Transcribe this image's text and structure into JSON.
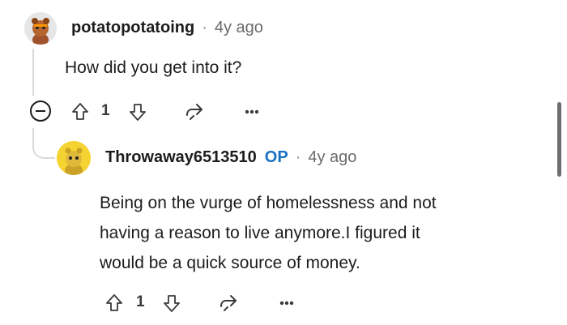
{
  "comment1": {
    "username": "potatopotatoing",
    "separator": "·",
    "time": "4y ago",
    "body": "How did you get into it?",
    "votes": "1",
    "icons": {
      "collapse": "collapse-minus-icon",
      "upvote": "upvote-arrow-icon",
      "downvote": "downvote-arrow-icon",
      "share": "share-icon",
      "more": "more-dots-icon"
    }
  },
  "comment2": {
    "username": "Throwaway6513510",
    "op_badge": "OP",
    "separator": "·",
    "time": "4y ago",
    "body_lines": [
      "Being on the vurge of homelessness and not",
      "having a reason to live anymore.I figured it",
      "would be a quick source of money."
    ],
    "votes": "1"
  },
  "colors": {
    "op": "#1a70c4",
    "avatar1_bg": "#eaeaea",
    "avatar2_bg": "#f5d331",
    "thread": "#d7dadc"
  }
}
